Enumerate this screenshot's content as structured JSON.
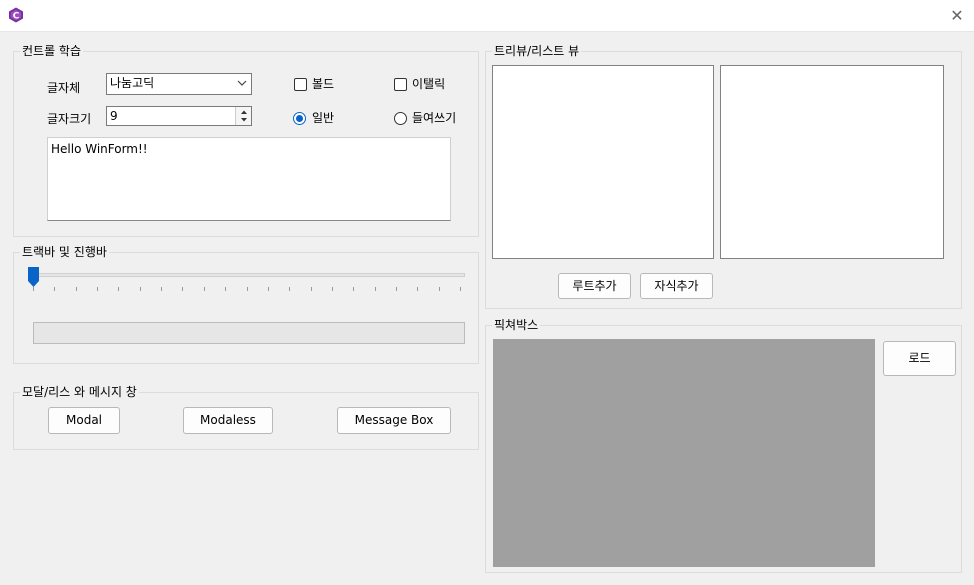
{
  "window": {
    "close_glyph": "✕"
  },
  "controls_group": {
    "title": "컨트롤 학습",
    "font_label": "글자체",
    "font_value": "나눔고딕",
    "size_label": "글자크기",
    "size_value": "9",
    "bold_label": "볼드",
    "italic_label": "이탤릭",
    "normal_label": "일반",
    "indent_label": "들여쓰기",
    "text_value": "Hello WinForm!!",
    "normal_selected": true
  },
  "trackbar_group": {
    "title": "트랙바 및 진행바",
    "trackbar_value": 0,
    "progress_value": 0
  },
  "modal_group": {
    "title": "모달/리스 와 메시지 창",
    "modal_label": "Modal",
    "modaless_label": "Modaless",
    "messagebox_label": "Message Box"
  },
  "tree_group": {
    "title": "트리뷰/리스트 뷰",
    "add_root_label": "루트추가",
    "add_child_label": "자식추가"
  },
  "picture_group": {
    "title": "픽쳐박스",
    "load_label": "로드"
  }
}
